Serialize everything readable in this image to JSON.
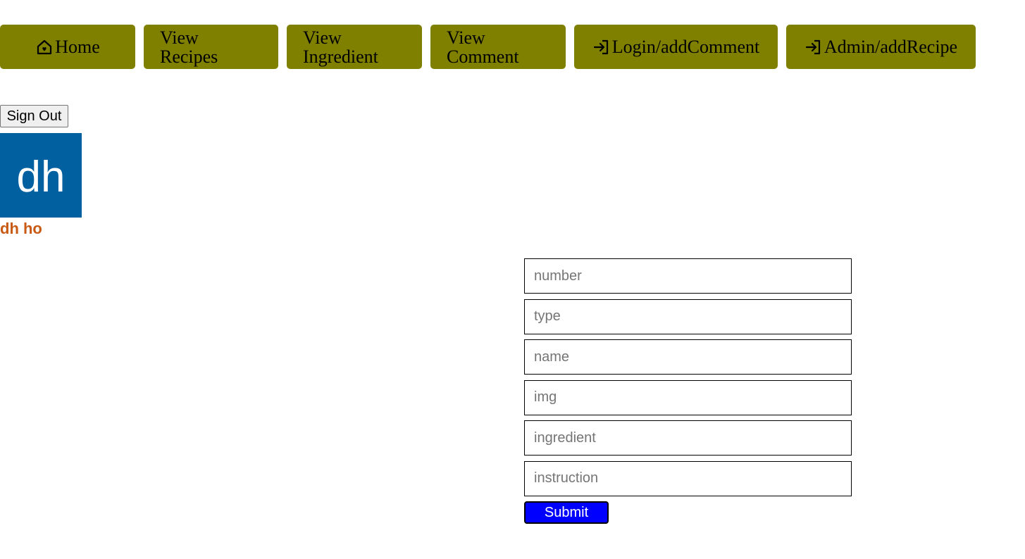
{
  "nav": {
    "home": {
      "label": "Home",
      "icon": "home-heart-icon"
    },
    "view_recipes": {
      "line1": "View",
      "line2": "Recipes"
    },
    "view_ingredient": {
      "line1": "View",
      "line2": "Ingredient"
    },
    "view_comment": {
      "line1": "View",
      "line2": "Comment"
    },
    "login_add_comment": {
      "label": "Login/addComment",
      "icon": "login-arrow-icon"
    },
    "admin_add_recipe": {
      "label": "Admin/addRecipe",
      "icon": "login-arrow-icon"
    },
    "button_color": "#808000"
  },
  "user": {
    "sign_out_label": "Sign Out",
    "avatar_initials": "dh",
    "avatar_color": "#0060a0",
    "name": "dh ho",
    "name_color": "#c85a14"
  },
  "form": {
    "fields": [
      {
        "placeholder": "number",
        "value": ""
      },
      {
        "placeholder": "type",
        "value": ""
      },
      {
        "placeholder": "name",
        "value": ""
      },
      {
        "placeholder": "img",
        "value": ""
      },
      {
        "placeholder": "ingredient",
        "value": ""
      },
      {
        "placeholder": "instruction",
        "value": ""
      }
    ],
    "submit_label": "Submit",
    "submit_color": "#0000ff"
  }
}
